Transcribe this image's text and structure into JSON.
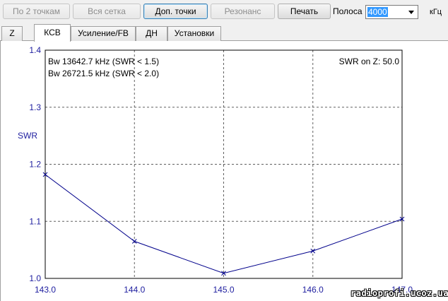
{
  "toolbar": {
    "btn_two_points": "По 2 точкам",
    "btn_all_grid": "Вся сетка",
    "btn_extra_points": "Доп. точки",
    "btn_resonance": "Резонанс",
    "btn_print": "Печать",
    "band_label": "Полоса",
    "band_value": "4000",
    "band_unit": "кГц"
  },
  "tabs": [
    {
      "label": "Z",
      "active": false
    },
    {
      "label": "КСВ",
      "active": true
    },
    {
      "label": "Усиление/FB",
      "active": false
    },
    {
      "label": "ДН",
      "active": false
    },
    {
      "label": "Установки",
      "active": false
    }
  ],
  "chart_data": {
    "type": "line",
    "ylabel": "SWR",
    "xlabel": "",
    "x": [
      143.0,
      144.0,
      145.0,
      146.0,
      147.0
    ],
    "y": [
      1.182,
      1.065,
      1.009,
      1.048,
      1.104
    ],
    "xlim": [
      143.0,
      147.0
    ],
    "ylim": [
      1.0,
      1.4
    ],
    "xticks": [
      "143.0",
      "144.0",
      "145.0",
      "146.0",
      "147.0"
    ],
    "yticks": [
      "1.0",
      "1.1",
      "1.2",
      "1.3",
      "1.4"
    ],
    "grid": true,
    "line_color": "#00008b",
    "annotations": {
      "bw1": "Bw 13642.7 kHz (SWR < 1.5)",
      "bw2": "Bw 26721.5 kHz (SWR < 2.0)",
      "z": "SWR on Z: 50.0"
    }
  },
  "watermark": "radioprofi.ucoz.ua"
}
